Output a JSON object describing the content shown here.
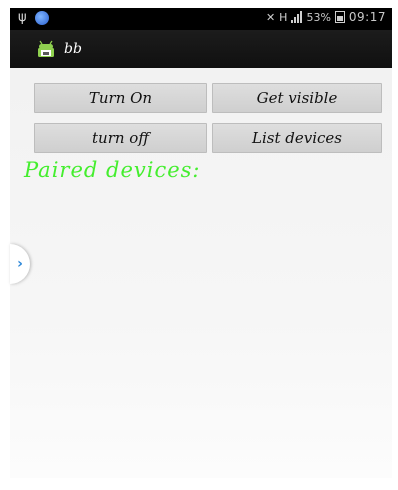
{
  "status_bar": {
    "usb_icon": "usb-icon",
    "battery_percent": "53%",
    "network_type": "H",
    "time": "09:17"
  },
  "action_bar": {
    "app_icon": "android-icon",
    "title": "bb"
  },
  "buttons": {
    "turn_on": "Turn On",
    "get_visible": "Get visible",
    "turn_off": "turn off",
    "list_devices": "List devices"
  },
  "paired_label": "Paired devices:",
  "side_tab": {
    "icon": "chevron-right-icon",
    "glyph": "›"
  },
  "colors": {
    "paired_label": "#44ee2e",
    "side_tab_chevron": "#2a86d8",
    "action_bar": "#151515"
  }
}
